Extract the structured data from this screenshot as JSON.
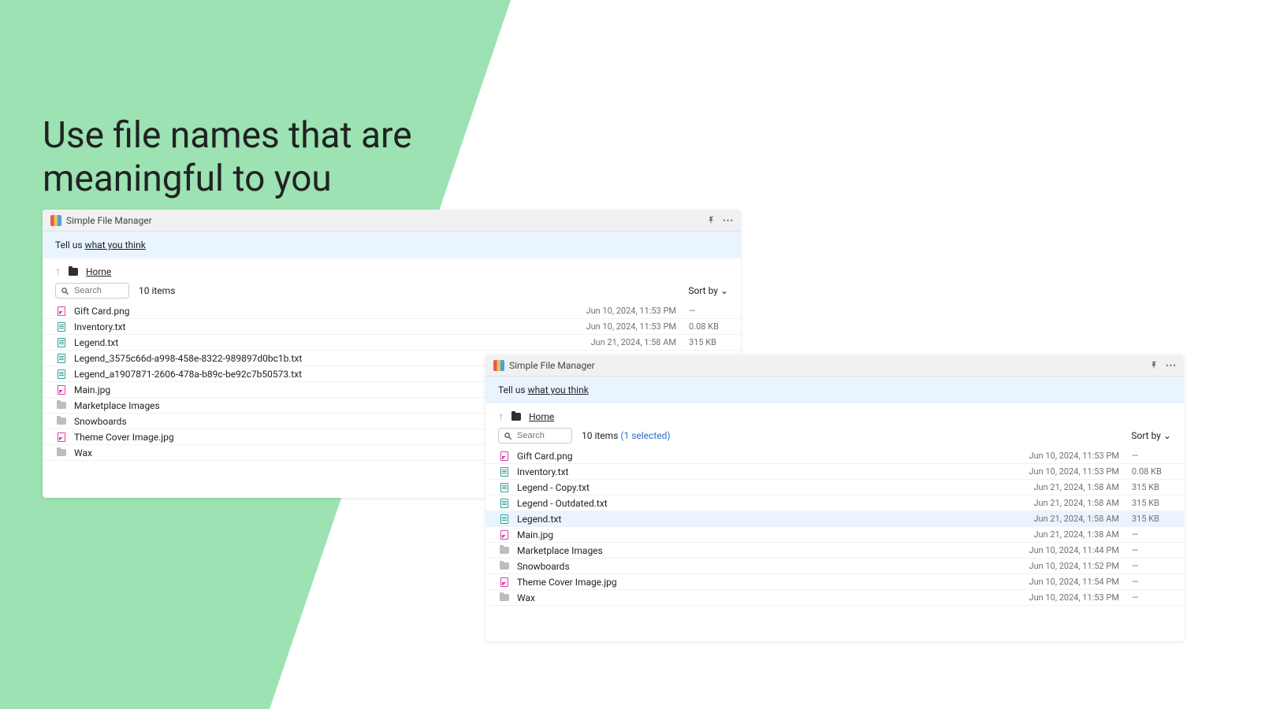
{
  "heading": "Use file names that are meaningful to you",
  "app_title": "Simple File Manager",
  "banner": {
    "prefix": "Tell us ",
    "link": "what you think"
  },
  "breadcrumb": {
    "home": "Home"
  },
  "search": {
    "placeholder": "Search"
  },
  "sort_label": "Sort by",
  "panel_a": {
    "count": "10 items",
    "rows": [
      {
        "type": "img",
        "name": "Gift Card.png",
        "date": "Jun 10, 2024, 11:53 PM",
        "size": "—"
      },
      {
        "type": "txt",
        "name": "Inventory.txt",
        "date": "Jun 10, 2024, 11:53 PM",
        "size": "0.08 KB"
      },
      {
        "type": "txt",
        "name": "Legend.txt",
        "date": "Jun 21, 2024, 1:58 AM",
        "size": "315 KB"
      },
      {
        "type": "txt",
        "name": "Legend_3575c66d-a998-458e-8322-989897d0bc1b.txt",
        "date": "",
        "size": ""
      },
      {
        "type": "txt",
        "name": "Legend_a1907871-2606-478a-b89c-be92c7b50573.txt",
        "date": "",
        "size": ""
      },
      {
        "type": "img",
        "name": "Main.jpg",
        "date": "",
        "size": ""
      },
      {
        "type": "folder",
        "name": "Marketplace Images",
        "date": "",
        "size": ""
      },
      {
        "type": "folder",
        "name": "Snowboards",
        "date": "",
        "size": ""
      },
      {
        "type": "img",
        "name": "Theme Cover Image.jpg",
        "date": "",
        "size": ""
      },
      {
        "type": "folder",
        "name": "Wax",
        "date": "",
        "size": ""
      }
    ]
  },
  "panel_b": {
    "count_prefix": "10 items",
    "selected_text": "(1 selected)",
    "rows": [
      {
        "type": "img",
        "name": "Gift Card.png",
        "date": "Jun 10, 2024, 11:53 PM",
        "size": "—",
        "selected": false
      },
      {
        "type": "txt",
        "name": "Inventory.txt",
        "date": "Jun 10, 2024, 11:53 PM",
        "size": "0.08 KB",
        "selected": false
      },
      {
        "type": "txt",
        "name": "Legend - Copy.txt",
        "date": "Jun 21, 2024, 1:58 AM",
        "size": "315 KB",
        "selected": false
      },
      {
        "type": "txt",
        "name": "Legend - Outdated.txt",
        "date": "Jun 21, 2024, 1:58 AM",
        "size": "315 KB",
        "selected": false
      },
      {
        "type": "txt",
        "name": "Legend.txt",
        "date": "Jun 21, 2024, 1:58 AM",
        "size": "315 KB",
        "selected": true
      },
      {
        "type": "img",
        "name": "Main.jpg",
        "date": "Jun 21, 2024, 1:38 AM",
        "size": "—",
        "selected": false
      },
      {
        "type": "folder",
        "name": "Marketplace Images",
        "date": "Jun 10, 2024, 11:44 PM",
        "size": "—",
        "selected": false
      },
      {
        "type": "folder",
        "name": "Snowboards",
        "date": "Jun 10, 2024, 11:52 PM",
        "size": "—",
        "selected": false
      },
      {
        "type": "img",
        "name": "Theme Cover Image.jpg",
        "date": "Jun 10, 2024, 11:54 PM",
        "size": "—",
        "selected": false
      },
      {
        "type": "folder",
        "name": "Wax",
        "date": "Jun 10, 2024, 11:53 PM",
        "size": "—",
        "selected": false
      }
    ]
  }
}
